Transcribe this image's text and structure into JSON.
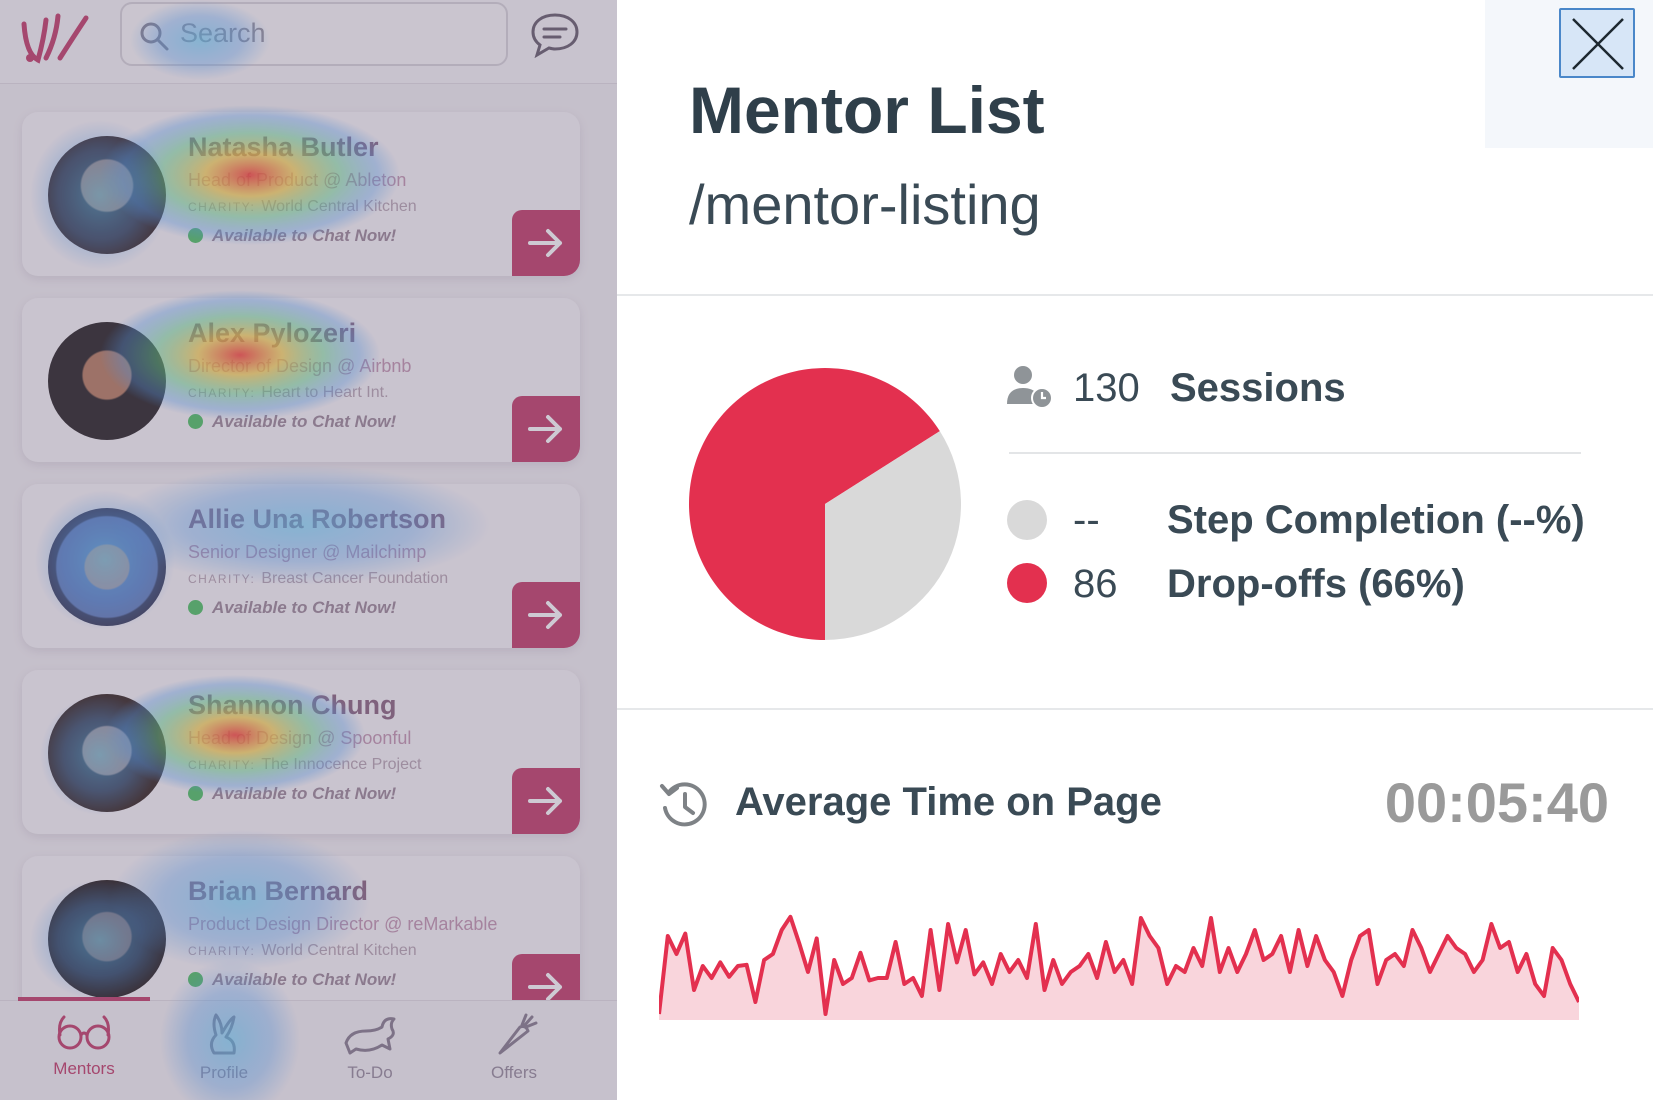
{
  "app": {
    "search_placeholder": "Search",
    "mentors": [
      {
        "name": "Natasha Butler",
        "role": "Head of Product @ Ableton",
        "charity_label": "CHARITY:",
        "charity": "World Central Kitchen",
        "status": "Available to Chat Now!"
      },
      {
        "name": "Alex Pylozeri",
        "role": "Director of Design @ Airbnb",
        "charity_label": "CHARITY:",
        "charity": "Heart to Heart Int.",
        "status": "Available to Chat Now!"
      },
      {
        "name": "Allie Una Robertson",
        "role": "Senior Designer @ Mailchimp",
        "charity_label": "CHARITY:",
        "charity": "Breast Cancer Foundation",
        "status": "Available to Chat Now!"
      },
      {
        "name": "Shannon Chung",
        "role": "Head of Design @ Spoonful",
        "charity_label": "CHARITY:",
        "charity": "The Innocence Project",
        "status": "Available to Chat Now!"
      },
      {
        "name": "Brian Bernard",
        "role": "Product Design Director @ reMarkable",
        "charity_label": "CHARITY:",
        "charity": "World Central Kitchen",
        "status": "Available to Chat Now!"
      }
    ],
    "nav": [
      {
        "label": "Mentors",
        "icon": "glasses-icon",
        "active": true
      },
      {
        "label": "Profile",
        "icon": "rabbit-sitting-icon",
        "active": false
      },
      {
        "label": "To-Do",
        "icon": "rabbit-running-icon",
        "active": false
      },
      {
        "label": "Offers",
        "icon": "carrot-icon",
        "active": false
      }
    ],
    "accent_color": "#c4446f"
  },
  "panel": {
    "title": "Mentor List",
    "path": "/mentor-listing",
    "sessions_count": "130",
    "sessions_label": "Sessions",
    "legend": [
      {
        "value": "--",
        "label": "Step Completion (--%)",
        "color": "#d9d9d9"
      },
      {
        "value": "86",
        "label": "Drop-offs (66%)",
        "color": "#e3304f"
      }
    ],
    "avg_label": "Average Time on Page",
    "avg_value": "00:05:40",
    "colors": {
      "drop": "#e3304f",
      "complete": "#d9d9d9",
      "spark_fill": "#f9d5dc"
    }
  },
  "chart_data": [
    {
      "type": "pie",
      "slices": [
        {
          "label": "Drop-offs",
          "value": 66
        },
        {
          "label": "Step Completion",
          "value": 34
        }
      ]
    },
    {
      "type": "area",
      "values": [
        5,
        70,
        55,
        72,
        25,
        45,
        35,
        48,
        36,
        45,
        46,
        15,
        50,
        55,
        75,
        86,
        64,
        40,
        68,
        5,
        50,
        30,
        35,
        56,
        33,
        35,
        35,
        65,
        30,
        35,
        20,
        75,
        25,
        80,
        48,
        75,
        38,
        48,
        30,
        55,
        40,
        50,
        35,
        80,
        25,
        50,
        30,
        40,
        45,
        55,
        35,
        65,
        40,
        50,
        30,
        85,
        70,
        60,
        30,
        45,
        40,
        60,
        45,
        85,
        40,
        60,
        40,
        55,
        75,
        50,
        55,
        70,
        40,
        75,
        45,
        70,
        50,
        40,
        20,
        50,
        70,
        75,
        30,
        50,
        55,
        45,
        75,
        60,
        40,
        55,
        70,
        60,
        55,
        40,
        50,
        80,
        60,
        65,
        40,
        55,
        30,
        20,
        60,
        50,
        30,
        15
      ],
      "ylim": [
        0,
        100
      ]
    }
  ]
}
